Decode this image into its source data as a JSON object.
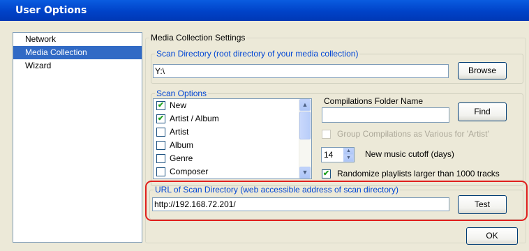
{
  "window": {
    "title": "User Options"
  },
  "nav": {
    "items": [
      {
        "label": "Network",
        "selected": false
      },
      {
        "label": "Media Collection",
        "selected": true
      },
      {
        "label": "Wizard",
        "selected": false
      }
    ]
  },
  "media": {
    "group_label": "Media Collection Settings",
    "scan_dir": {
      "legend": "Scan Directory  (root directory of your media collection)",
      "value": "Y:\\",
      "browse_label": "Browse"
    },
    "scan_options": {
      "legend": "Scan Options",
      "items": [
        {
          "label": "New",
          "checked": true
        },
        {
          "label": "Artist / Album",
          "checked": true
        },
        {
          "label": "Artist",
          "checked": false
        },
        {
          "label": "Album",
          "checked": false
        },
        {
          "label": "Genre",
          "checked": false
        },
        {
          "label": "Composer",
          "checked": false
        }
      ],
      "compilations_label": "Compilations Folder Name",
      "compilations_value": "",
      "find_label": "Find",
      "group_compilations_label": "Group Compilations as Various for 'Artist'",
      "group_compilations_checked": false,
      "cutoff_value": "14",
      "cutoff_label": "New music cutoff (days)",
      "randomize_label": "Randomize playlists larger than 1000 tracks",
      "randomize_checked": true
    },
    "url": {
      "legend": "URL of Scan Directory  (web accessible address of scan directory)",
      "value": "http://192.168.72.201/",
      "test_label": "Test"
    }
  },
  "footer": {
    "ok_label": "OK"
  },
  "colors": {
    "title_bar": "#0054e3",
    "selection": "#316ac5",
    "highlight": "#e0201e",
    "legend_text": "#0046d5"
  }
}
